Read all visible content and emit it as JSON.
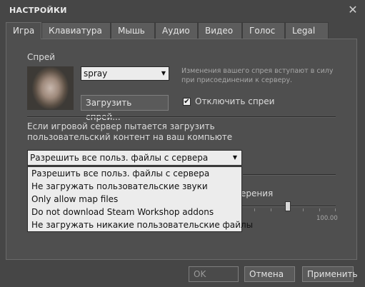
{
  "window": {
    "title": "НАСТРОЙКИ",
    "close_glyph": "✕"
  },
  "tabs": [
    "Игра",
    "Клавиатура",
    "Мышь",
    "Аудио",
    "Видео",
    "Голос",
    "Legal"
  ],
  "active_tab": "Игра",
  "spray": {
    "section_label": "Спрей",
    "selected": "spray",
    "upload_button": "Загрузить спрей...",
    "info_text_line1": "Изменения вашего спрея вступают в силу",
    "info_text_line2": "при присоединении к серверу.",
    "disable_label": "Отключить спреи",
    "disable_checked": true,
    "check_glyph": "✔"
  },
  "download": {
    "question_line1": "Если игровой сервер пытается загрузить",
    "question_line2": "пользовательский контент на ваш компьюте",
    "selected": "Разрешить все польз. файлы с сервера",
    "options": [
      "Разрешить все польз. файлы с сервера",
      "Не загружать пользовательские звуки",
      "Only allow map files",
      "Do not download Steam Workshop addons",
      "Не загружать никакие пользовательские файлы"
    ]
  },
  "slider": {
    "partial_label": "ерения",
    "max_value_label": "100.00"
  },
  "footer": {
    "ok": "OK",
    "cancel": "Отмена",
    "apply": "Применить"
  },
  "colors": {
    "background": "#464646",
    "panel": "#4f4f4f",
    "field": "#ececec"
  }
}
